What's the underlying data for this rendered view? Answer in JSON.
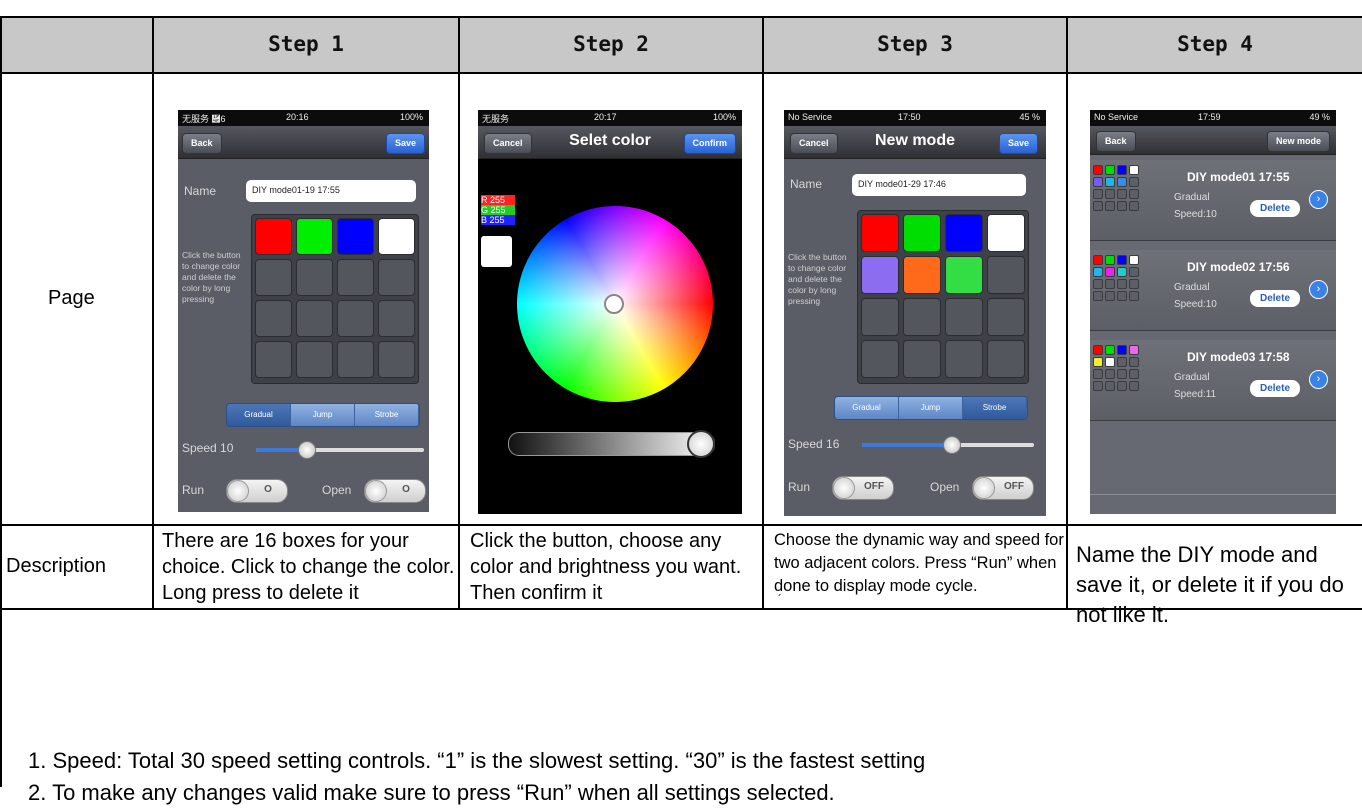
{
  "table": {
    "header": {
      "steps": [
        "Step 1",
        "Step 2",
        "Step 3",
        "Step 4"
      ]
    },
    "row_labels": {
      "page": "Page",
      "description": "Description"
    },
    "descriptions": [
      "There are 16 boxes for your choice. Click to change the color. Long press to delete it",
      "Click the button, choose any color and brightness you want. Then confirm it",
      "Choose the dynamic way and speed for two adjacent colors. Press “Run” when done to display mode cycle.",
      "Name the DIY mode and save it, or delete it if you do not like it."
    ],
    "stray_mark": "´"
  },
  "screens": {
    "s1": {
      "status": {
        "carrier": "无服务 ὏6",
        "time": "20:16",
        "battery": "100%"
      },
      "back": "Back",
      "save": "Save",
      "name_label": "Name",
      "name_value": "DIY mode01-19 17:55",
      "hint": "Click the button to change color and delete the color by long pressing",
      "modes": [
        "Gradual",
        "Jump",
        "Strobe"
      ],
      "selected_mode": "Gradual",
      "speed_label": "Speed 10",
      "speed_fraction": 0.3,
      "run_label": "Run",
      "run_toggle": "O",
      "open_label": "Open",
      "open_toggle": "O",
      "colors": [
        "#ff0000",
        "#00ee00",
        "#0000ff",
        "#ffffff"
      ]
    },
    "s2": {
      "status": {
        "carrier": "无服务",
        "time": "20:17",
        "battery": "100%"
      },
      "cancel": "Cancel",
      "title": "Selet color",
      "confirm": "Confirm",
      "r": "R 255",
      "g": "G 255",
      "b": "B 255",
      "brightness_fraction": 1.0
    },
    "s3": {
      "status": {
        "carrier": "No Service",
        "time": "17:50",
        "battery": "45 %"
      },
      "cancel": "Cancel",
      "title": "New mode",
      "save": "Save",
      "name_label": "Name",
      "name_value": "DIY mode01-29 17:46",
      "hint": "Click the button to change color and delete the color by long pressing",
      "modes": [
        "Gradual",
        "Jump",
        "Strobe"
      ],
      "selected_mode": "Strobe",
      "speed_label": "Speed  16",
      "speed_fraction": 0.52,
      "run_label": "Run",
      "run_toggle": "OFF",
      "open_label": "Open",
      "open_toggle": "OFF",
      "colors": [
        "#ff0000",
        "#00dd00",
        "#0000ff",
        "#ffffff",
        "#8c6cf0",
        "#ff6a1a",
        "#33dd44"
      ]
    },
    "s4": {
      "status": {
        "carrier": "No Service",
        "time": "17:59",
        "battery": "49 %"
      },
      "back": "Back",
      "new_mode": "New mode",
      "items": [
        {
          "name": "DIY mode01 17:55",
          "gradual": "Gradual",
          "speed": "Speed:10",
          "delete": "Delete",
          "colors": [
            "#ff0000",
            "#00dd00",
            "#0000ff",
            "#ffffff",
            "#7a5ce6",
            "#22b5e6",
            "#3b8ae6"
          ]
        },
        {
          "name": "DIY mode02 17:56",
          "gradual": "Gradual",
          "speed": "Speed:10",
          "delete": "Delete",
          "colors": [
            "#ff0000",
            "#00dd00",
            "#0000ff",
            "#ffffff",
            "#22b5e6",
            "#ee22ee",
            "#22cccc"
          ]
        },
        {
          "name": "DIY mode03 17:58",
          "gradual": "Gradual",
          "speed": "Speed:11",
          "delete": "Delete",
          "colors": [
            "#ff0000",
            "#00dd00",
            "#0000ff",
            "#ee66ee",
            "#eeee33",
            "#ffffff"
          ]
        }
      ]
    }
  },
  "notes": [
    "1. Speed:  Total 30 speed setting controls.   “1” is the slowest setting. “30” is the fastest setting",
    "2. To make any changes valid make sure to press “Run” when all settings selected."
  ]
}
